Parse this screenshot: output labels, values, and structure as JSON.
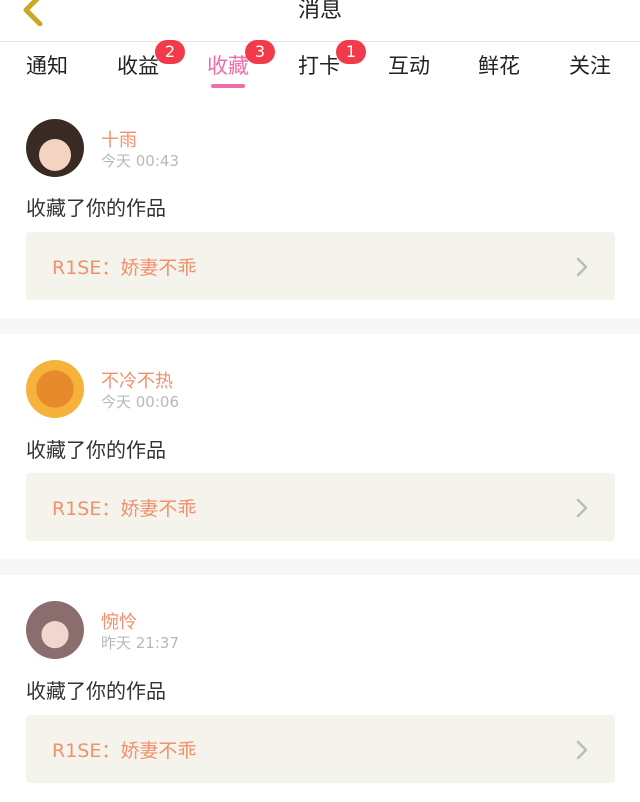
{
  "header": {
    "title": "消息"
  },
  "tabs": [
    {
      "label": "通知",
      "badge": null
    },
    {
      "label": "收益",
      "badge": "2"
    },
    {
      "label": "收藏",
      "badge": "3",
      "active": true
    },
    {
      "label": "打卡",
      "badge": "1"
    },
    {
      "label": "互动",
      "badge": null
    },
    {
      "label": "鲜花",
      "badge": null
    },
    {
      "label": "关注",
      "badge": null
    }
  ],
  "messages": [
    {
      "username": "十雨",
      "time": "今天 00:43",
      "action": "收藏了你的作品",
      "work_title": "R1SE：娇妻不乖"
    },
    {
      "username": "不冷不热",
      "time": "今天 00:06",
      "action": "收藏了你的作品",
      "work_title": "R1SE：娇妻不乖"
    },
    {
      "username": "惋怜",
      "time": "昨天 21:37",
      "action": "收藏了你的作品",
      "work_title": "R1SE：娇妻不乖"
    }
  ],
  "colors": {
    "accent": "#ef6da8",
    "badge": "#f23a4b",
    "name": "#f0906d",
    "card_bg": "#f4f4ec"
  }
}
